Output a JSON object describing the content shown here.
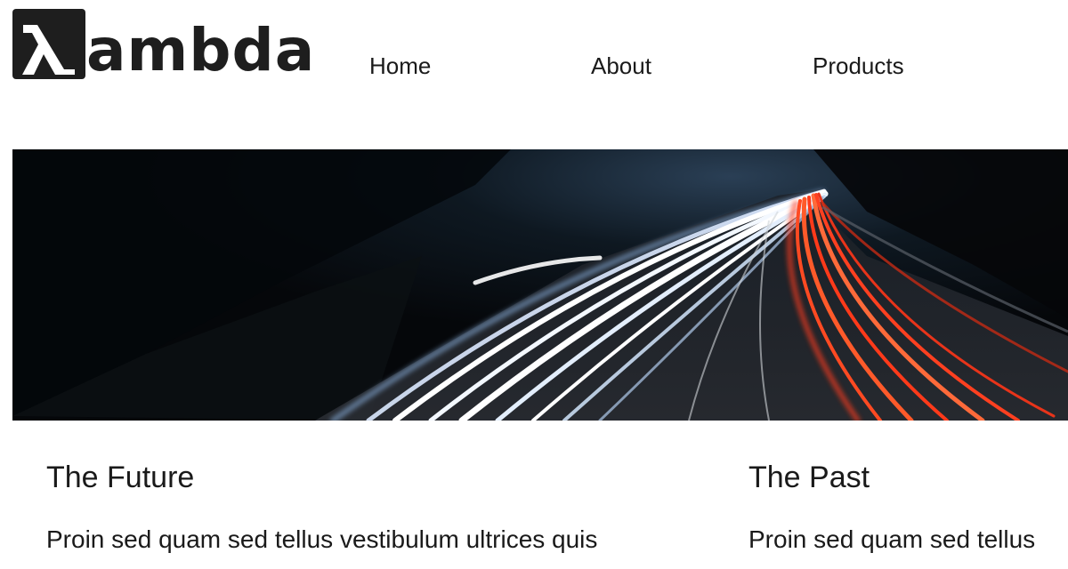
{
  "header": {
    "logo": {
      "text": "ambda",
      "glyph": "λ",
      "icon": "lambda-icon",
      "colors": {
        "mark_bg": "#1e1e1e",
        "mark_fg": "#ffffff"
      }
    },
    "nav": [
      {
        "label": "Home"
      },
      {
        "label": "About"
      },
      {
        "label": "Products"
      },
      {
        "label": ""
      }
    ]
  },
  "hero": {
    "image": "night-highway-light-trails-photo",
    "colors": {
      "sky": "#0b141d",
      "white_trails": "#e8f2ff",
      "red_trails": "#ff3a1a"
    }
  },
  "articles": [
    {
      "title": "The Future",
      "body": "Proin sed quam sed tellus vestibulum ultrices quis"
    },
    {
      "title": "The Past",
      "body": "Proin sed quam sed tellus"
    }
  ]
}
